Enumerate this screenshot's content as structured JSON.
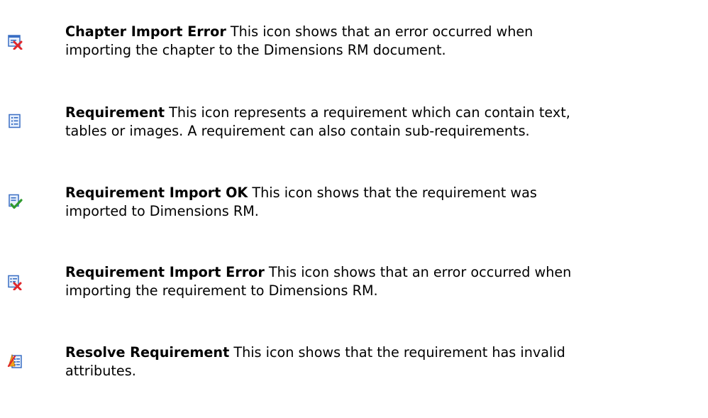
{
  "entries": [
    {
      "icon": "chapter-import-error-icon",
      "term": "Chapter Import Error",
      "text": " This icon shows that an error occurred when\nimporting the chapter to the Dimensions RM document."
    },
    {
      "icon": "requirement-icon",
      "term": "Requirement",
      "text": " This icon represents a requirement which can contain text,\ntables or images. A requirement can also contain sub-requirements."
    },
    {
      "icon": "requirement-import-ok-icon",
      "term": "Requirement Import OK",
      "text": " This icon shows that the requirement was\nimported to Dimensions RM."
    },
    {
      "icon": "requirement-import-error-icon",
      "term": "Requirement Import Error",
      "text": " This icon shows that an error occurred when\nimporting the requirement to Dimensions RM."
    },
    {
      "icon": "resolve-requirement-icon",
      "term": "Resolve Requirement",
      "text": " This icon shows that the requirement has invalid\nattributes."
    }
  ],
  "colors": {
    "doc_blue": "#3a6fc4",
    "doc_light": "#e6effc",
    "error_red": "#e0262b",
    "ok_green": "#2f9a2f",
    "warn_orange": "#f0a21c"
  }
}
